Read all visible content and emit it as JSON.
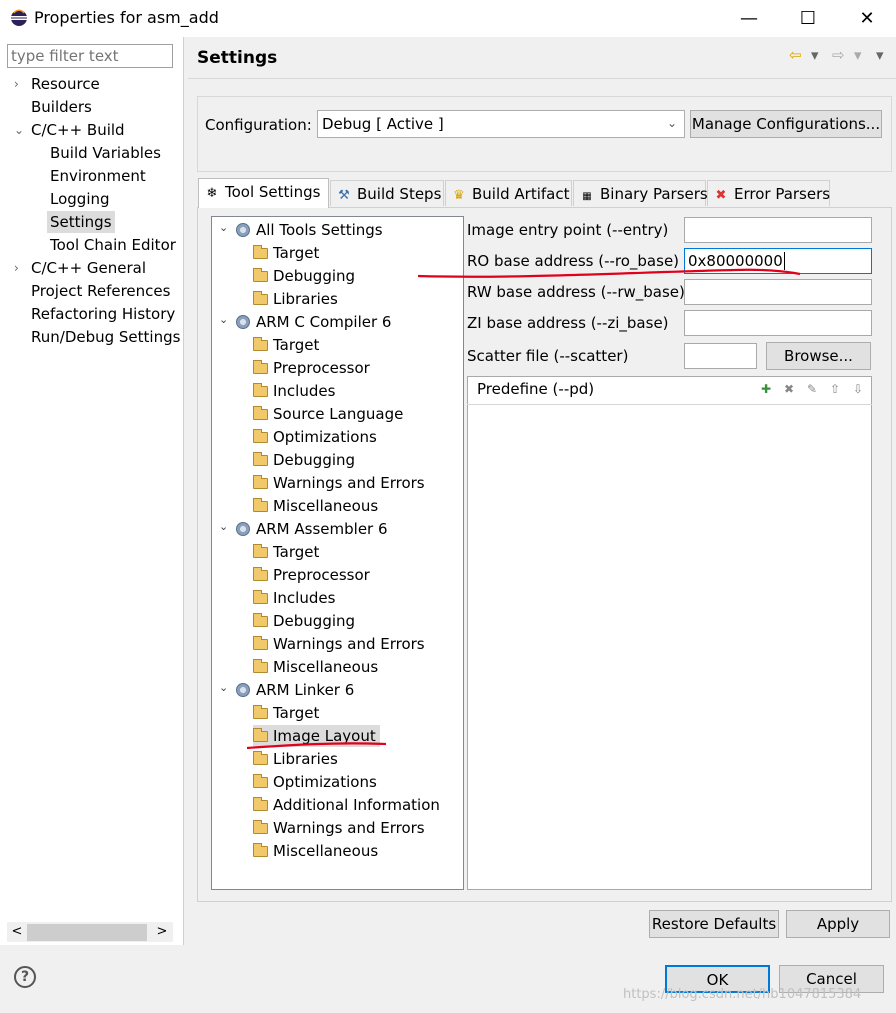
{
  "window": {
    "title": "Properties for asm_add",
    "minimize_glyph": "—",
    "maximize_glyph": "☐",
    "close_glyph": "✕"
  },
  "left_nav": {
    "filter_placeholder": "type filter text",
    "items": [
      {
        "label": "Resource",
        "expander": "›"
      },
      {
        "label": "Builders"
      },
      {
        "label": "C/C++ Build",
        "expander": "⌄"
      },
      {
        "label": "Build Variables"
      },
      {
        "label": "Environment"
      },
      {
        "label": "Logging"
      },
      {
        "label": "Settings",
        "selected": true
      },
      {
        "label": "Tool Chain Editor"
      },
      {
        "label": "C/C++ General",
        "expander": "›"
      },
      {
        "label": "Project References"
      },
      {
        "label": "Refactoring History"
      },
      {
        "label": "Run/Debug Settings"
      }
    ],
    "scroll_left": "<",
    "scroll_right": ">"
  },
  "header": {
    "title": "Settings",
    "back_glyph": "⇦",
    "forward_glyph": "⇨",
    "menu_glyph": "▾"
  },
  "configuration": {
    "label": "Configuration:",
    "value": "Debug  [ Active ]",
    "manage_button": "Manage Configurations..."
  },
  "tabs": [
    {
      "label": "Tool Settings",
      "icon": "tool-settings-icon",
      "active": true
    },
    {
      "label": "Build Steps",
      "icon": "build-steps-icon"
    },
    {
      "label": "Build Artifact",
      "icon": "trophy-icon"
    },
    {
      "label": "Binary Parsers",
      "icon": "binary-icon"
    },
    {
      "label": "Error Parsers",
      "icon": "error-icon"
    }
  ],
  "tree": {
    "groups": [
      {
        "label": "All Tools Settings",
        "children": [
          "Target",
          "Debugging",
          "Libraries"
        ]
      },
      {
        "label": "ARM C Compiler 6",
        "children": [
          "Target",
          "Preprocessor",
          "Includes",
          "Source Language",
          "Optimizations",
          "Debugging",
          "Warnings and Errors",
          "Miscellaneous"
        ]
      },
      {
        "label": "ARM Assembler 6",
        "children": [
          "Target",
          "Preprocessor",
          "Includes",
          "Debugging",
          "Warnings and Errors",
          "Miscellaneous"
        ]
      },
      {
        "label": "ARM Linker 6",
        "children": [
          "Target",
          "Image Layout",
          "Libraries",
          "Optimizations",
          "Additional Information",
          "Warnings and Errors",
          "Miscellaneous"
        ]
      }
    ],
    "selected": "Image Layout"
  },
  "form": {
    "entry_label": "Image entry point (--entry)",
    "entry_value": "",
    "ro_label": "RO base address (--ro_base)",
    "ro_value": "0x80000000",
    "rw_label": "RW base address (--rw_base)",
    "rw_value": "",
    "zi_label": "ZI base address (--zi_base)",
    "zi_value": "",
    "scatter_label": "Scatter file (--scatter)",
    "scatter_value": "",
    "browse_button": "Browse...",
    "predefine_label": "Predefine (--pd)"
  },
  "buttons": {
    "restore_defaults": "Restore Defaults",
    "apply": "Apply",
    "ok": "OK",
    "cancel": "Cancel",
    "help": "?"
  },
  "watermark": "https://blog.csdn.net/hb1047815384",
  "colors": {
    "annotation": "#e0001b",
    "focus_border": "#0078d7",
    "selection": "#dcdcdc"
  }
}
